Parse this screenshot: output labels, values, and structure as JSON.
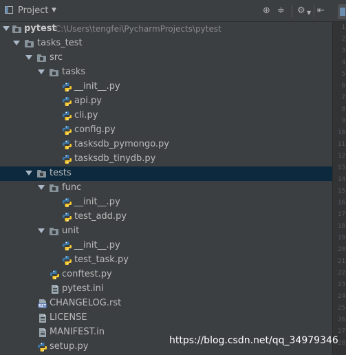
{
  "panel": {
    "title": "Project",
    "title_icon": "project-icon",
    "dropdown_icon": "caret-down-icon",
    "tools": [
      {
        "name": "locate-icon",
        "glyph": "⊕"
      },
      {
        "name": "collapse-all-icon",
        "glyph": "≑"
      },
      {
        "name": "settings-icon",
        "glyph": "⚙"
      },
      {
        "name": "hide-icon",
        "glyph": "⇤"
      }
    ]
  },
  "tree": {
    "root": {
      "label": "pytest",
      "path": "C:\\Users\\tengfei\\PycharmProjects\\pytest"
    },
    "tasks_test": "tasks_test",
    "src": "src",
    "tasks": "tasks",
    "tasks_files": [
      "__init__.py",
      "api.py",
      "cli.py",
      "config.py",
      "tasksdb_pymongo.py",
      "tasksdb_tinydb.py"
    ],
    "tests": "tests",
    "func": "func",
    "func_files": [
      "__init__.py",
      "test_add.py"
    ],
    "unit": "unit",
    "unit_files": [
      "__init__.py",
      "test_task.py"
    ],
    "tests_files": [
      "conftest.py",
      "pytest.ini"
    ],
    "root_files": [
      "CHANGELOG.rst",
      "LICENSE",
      "MANIFEST.in",
      "setup.py"
    ],
    "selected_item": "tests"
  },
  "gutter": {
    "line_numbers": [
      "1",
      "2",
      "3",
      "4",
      "5",
      "6",
      "7",
      "8",
      "9",
      "10",
      "11",
      "12",
      "13",
      "14",
      "15",
      "16",
      "17",
      "18",
      "19",
      "20",
      "21",
      "22",
      "23",
      "24",
      "25",
      "26",
      "27",
      "28"
    ]
  },
  "watermark": "https://blog.csdn.net/qq_34979346",
  "colors": {
    "background": "#3c3f41",
    "selection": "#0d293e",
    "text": "#bbbbbb",
    "path_text": "#888a8c",
    "folder": "#87939a",
    "python_blue": "#3b77a8",
    "python_yellow": "#f7c932"
  }
}
